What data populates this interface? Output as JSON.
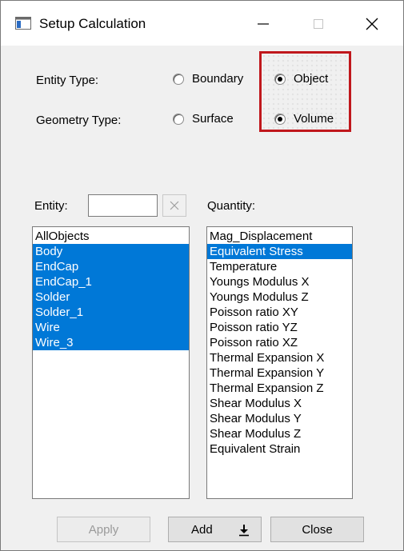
{
  "window": {
    "title": "Setup Calculation"
  },
  "entity_type": {
    "label": "Entity Type:",
    "options": [
      {
        "label": "Boundary",
        "checked": false
      },
      {
        "label": "Object",
        "checked": true
      }
    ]
  },
  "geometry_type": {
    "label": "Geometry Type:",
    "options": [
      {
        "label": "Surface",
        "checked": false
      },
      {
        "label": "Volume",
        "checked": true
      }
    ]
  },
  "entity": {
    "label": "Entity:",
    "filter_value": "",
    "items": [
      {
        "text": "AllObjects",
        "selected": false
      },
      {
        "text": "Body",
        "selected": true
      },
      {
        "text": "EndCap",
        "selected": true
      },
      {
        "text": "EndCap_1",
        "selected": true
      },
      {
        "text": "Solder",
        "selected": true
      },
      {
        "text": "Solder_1",
        "selected": true
      },
      {
        "text": "Wire",
        "selected": true
      },
      {
        "text": "Wire_3",
        "selected": true
      }
    ]
  },
  "quantity": {
    "label": "Quantity:",
    "items": [
      {
        "text": "Mag_Displacement",
        "selected": false
      },
      {
        "text": "Equivalent Stress",
        "selected": true
      },
      {
        "text": "Temperature",
        "selected": false
      },
      {
        "text": "Youngs Modulus X",
        "selected": false
      },
      {
        "text": "Youngs Modulus Z",
        "selected": false
      },
      {
        "text": "Poisson ratio XY",
        "selected": false
      },
      {
        "text": "Poisson ratio YZ",
        "selected": false
      },
      {
        "text": "Poisson ratio XZ",
        "selected": false
      },
      {
        "text": "Thermal Expansion X",
        "selected": false
      },
      {
        "text": "Thermal Expansion Y",
        "selected": false
      },
      {
        "text": "Thermal Expansion Z",
        "selected": false
      },
      {
        "text": "Shear Modulus X",
        "selected": false
      },
      {
        "text": "Shear Modulus Y",
        "selected": false
      },
      {
        "text": "Shear Modulus Z",
        "selected": false
      },
      {
        "text": "Equivalent Strain",
        "selected": false
      }
    ]
  },
  "buttons": {
    "apply": "Apply",
    "add": "Add",
    "close": "Close"
  },
  "colors": {
    "selection": "#0078d7",
    "highlight_border": "#c0171c"
  }
}
